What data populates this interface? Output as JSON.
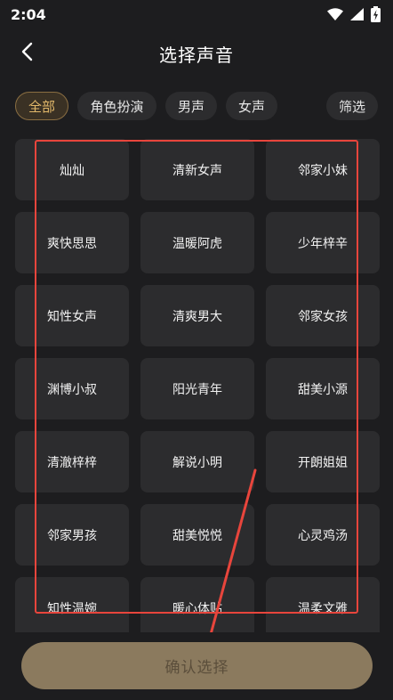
{
  "status_bar": {
    "time": "2:04"
  },
  "header": {
    "title": "选择声音"
  },
  "filters": {
    "tabs": [
      {
        "label": "全部",
        "active": true
      },
      {
        "label": "角色扮演",
        "active": false
      },
      {
        "label": "男声",
        "active": false
      },
      {
        "label": "女声",
        "active": false
      }
    ],
    "screen_label": "筛选"
  },
  "voices": [
    "灿灿",
    "清新女声",
    "邻家小妹",
    "爽快思思",
    "温暖阿虎",
    "少年梓辛",
    "知性女声",
    "清爽男大",
    "邻家女孩",
    "渊博小叔",
    "阳光青年",
    "甜美小源",
    "清澈梓梓",
    "解说小明",
    "开朗姐姐",
    "邻家男孩",
    "甜美悦悦",
    "心灵鸡汤",
    "知性温婉",
    "暖心体贴",
    "温柔文雅"
  ],
  "footer": {
    "confirm_label": "确认选择"
  },
  "colors": {
    "background": "#1d1d1f",
    "card": "#2c2c2e",
    "accent": "#e2b86a",
    "confirm_button": "#8b7a5e",
    "annotation": "#e8453c"
  }
}
